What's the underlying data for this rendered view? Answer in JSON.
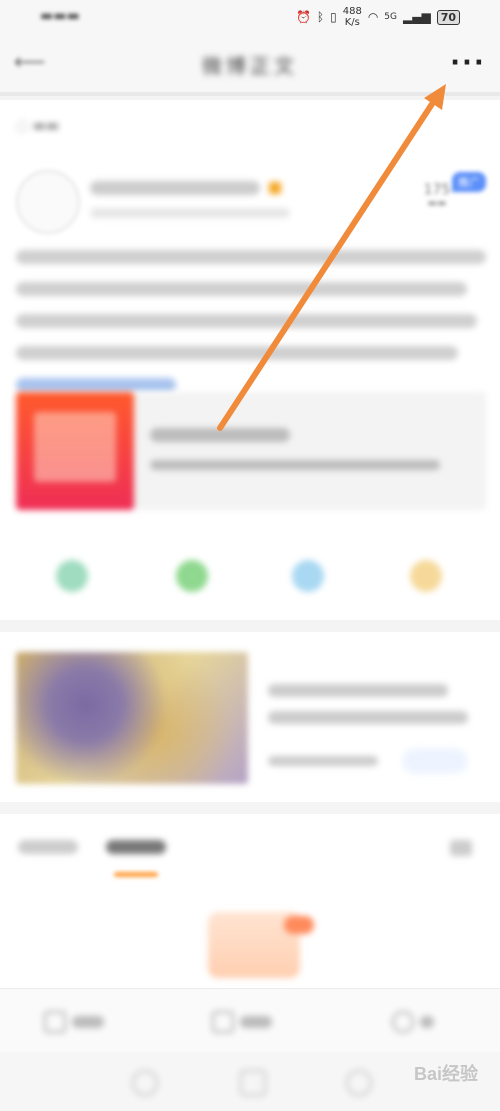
{
  "status_bar": {
    "network_speed_value": "488",
    "network_speed_unit": "K/s",
    "signal_label": "5G",
    "battery": "70"
  },
  "nav": {
    "back_icon": "back-arrow-icon",
    "title": "微博正文",
    "more_label": "···"
  },
  "post": {
    "read_count": "175",
    "promo_badge": "推广"
  },
  "watermark": "Bai经验",
  "colors": {
    "arrow": "#f08b3c",
    "promo_badge": "#5b8ff9",
    "tab_underline": "#ffa040"
  }
}
